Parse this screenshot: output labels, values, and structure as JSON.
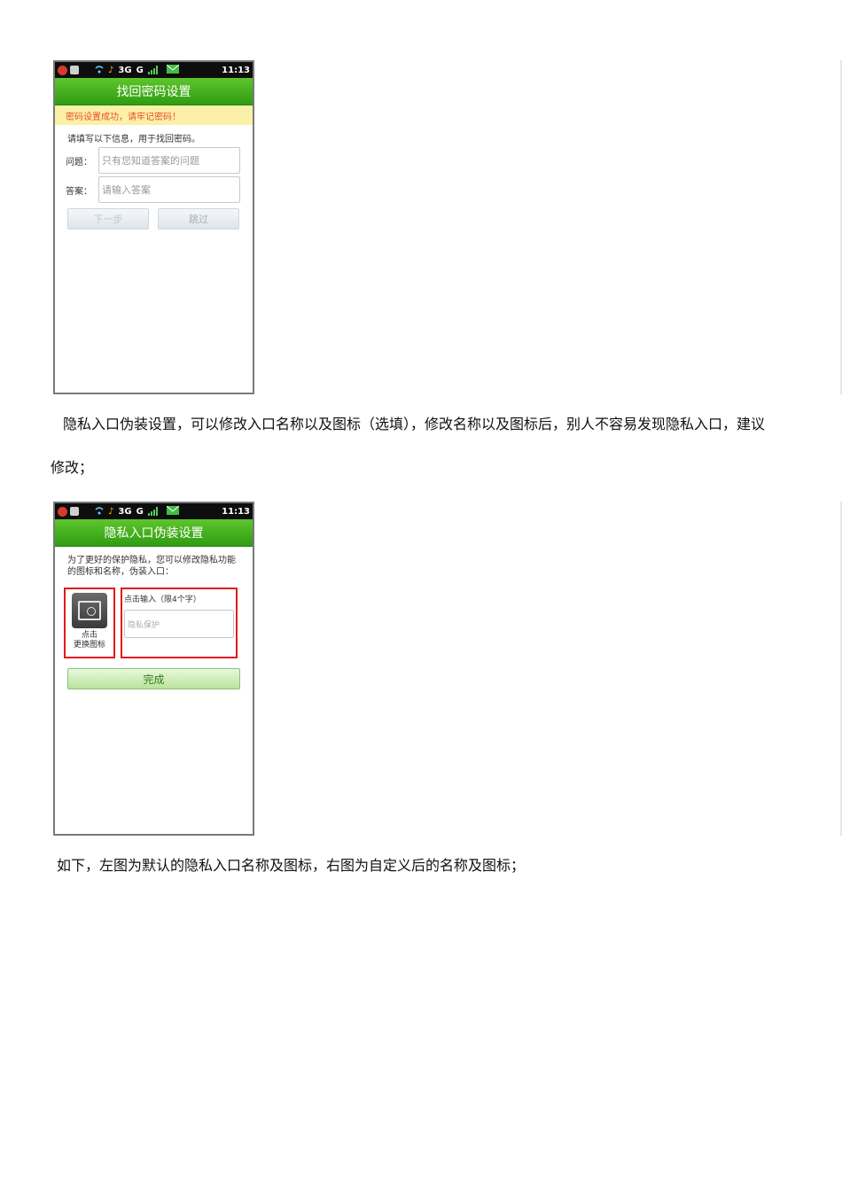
{
  "screen1": {
    "status_time": "11:13",
    "status_network": "3G",
    "status_gsm": "G",
    "title": "找回密码设置",
    "notice": "密码设置成功，请牢记密码！",
    "intro": "请填写以下信息，用于找回密码。",
    "question_label": "问题：",
    "question_placeholder": "只有您知道答案的问题",
    "answer_label": "答案：",
    "answer_placeholder": "请输入答案",
    "next_label": "下一步",
    "skip_label": "跳过"
  },
  "paragraph1_line1": "隐私入口伪装设置，可以修改入口名称以及图标（选填），修改名称以及图标后，别人不容易发现隐私入口，建议",
  "paragraph1_line2": "修改；",
  "screen2": {
    "status_time": "11:13",
    "status_network": "3G",
    "status_gsm": "G",
    "title": "隐私入口伪装设置",
    "intro": "为了更好的保护隐私，您可以修改隐私功能的图标和名称，伪装入口：",
    "icon_caption_1": "点击",
    "icon_caption_2": "更换图标",
    "name_hint": "点击输入（限4个字）",
    "name_placeholder": "隐私保护",
    "done_label": "完成"
  },
  "paragraph2": "如下，左图为默认的隐私入口名称及图标，右图为自定义后的名称及图标；"
}
